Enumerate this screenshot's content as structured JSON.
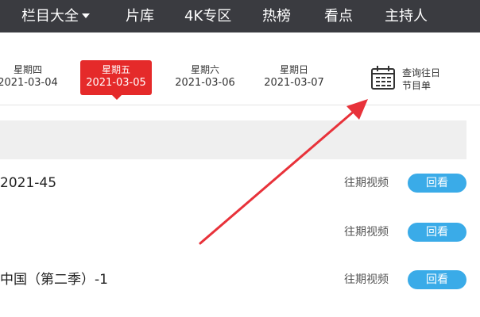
{
  "nav": {
    "items": [
      {
        "label": "栏目大全",
        "has_dropdown": true
      },
      {
        "label": "片库"
      },
      {
        "label": "4K专区"
      },
      {
        "label": "热榜"
      },
      {
        "label": "看点"
      },
      {
        "label": "主持人"
      }
    ]
  },
  "dates": [
    {
      "weekday": "星期四",
      "date": "2021-03-04",
      "active": false
    },
    {
      "weekday": "星期五",
      "date": "2021-03-05",
      "active": true
    },
    {
      "weekday": "星期六",
      "date": "2021-03-06",
      "active": false
    },
    {
      "weekday": "星期日",
      "date": "2021-03-07",
      "active": false
    }
  ],
  "history": {
    "line1": "查询往日",
    "line2": "节目单",
    "icon": "calendar-icon"
  },
  "programs": [
    {
      "title": "2021-45",
      "type": "往期视频",
      "button": "回看"
    },
    {
      "title": "",
      "type": "往期视频",
      "button": "回看"
    },
    {
      "title": "中国（第二季）-1",
      "type": "往期视频",
      "button": "回看"
    }
  ],
  "colors": {
    "nav_bg": "#3a3b40",
    "active_tab": "#e52a2a",
    "button": "#3aabe8",
    "arrow": "#e8323a"
  }
}
